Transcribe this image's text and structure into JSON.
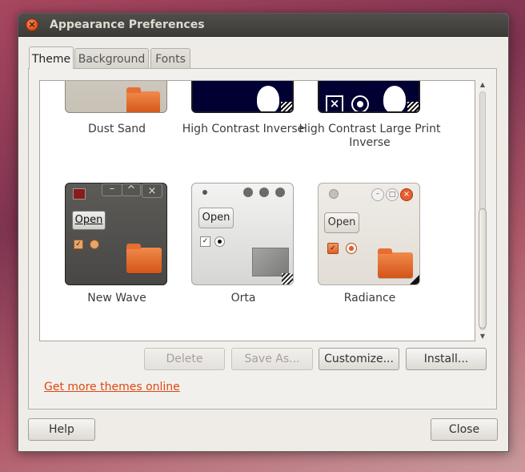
{
  "window": {
    "title": "Appearance Preferences",
    "close_icon": "close-icon"
  },
  "tabs": [
    {
      "label": "Theme",
      "active": true
    },
    {
      "label": "Background",
      "active": false
    },
    {
      "label": "Fonts",
      "active": false
    }
  ],
  "themes": [
    {
      "name": "Dust Sand"
    },
    {
      "name": "High Contrast Inverse"
    },
    {
      "name": "High Contrast Large Print Inverse"
    },
    {
      "name": "New Wave",
      "preview_button": "Open"
    },
    {
      "name": "Orta",
      "preview_button": "Open"
    },
    {
      "name": "Radiance",
      "preview_button": "Open"
    }
  ],
  "actions": {
    "delete_label": "Delete",
    "save_as_label": "Save As...",
    "customize_label": "Customize...",
    "install_label": "Install..."
  },
  "more_themes_link": "Get more themes online",
  "footer": {
    "help_label": "Help",
    "close_label": "Close"
  },
  "colors": {
    "accent": "#dd4814",
    "titlebar": "#3c3b37",
    "window_bg": "#efece8"
  }
}
